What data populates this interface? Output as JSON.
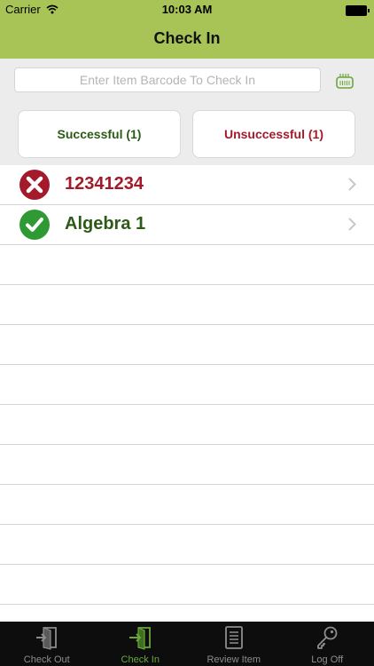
{
  "status_bar": {
    "carrier": "Carrier",
    "time": "10:03 AM"
  },
  "nav": {
    "title": "Check In"
  },
  "search": {
    "placeholder": "Enter Item Barcode To Check In",
    "value": ""
  },
  "filters": {
    "successful_label": "Successful (1)",
    "unsuccessful_label": "Unsuccessful (1)"
  },
  "items": [
    {
      "label": "12341234",
      "status": "error",
      "color": "#a31b2a"
    },
    {
      "label": "Algebra 1",
      "status": "success",
      "color": "#2d5a16"
    }
  ],
  "tabs": [
    {
      "label": "Check Out",
      "icon": "check-out-icon",
      "active": false
    },
    {
      "label": "Check In",
      "icon": "check-in-icon",
      "active": true
    },
    {
      "label": "Review Item",
      "icon": "review-item-icon",
      "active": false
    },
    {
      "label": "Log Off",
      "icon": "key-icon",
      "active": false
    }
  ],
  "colors": {
    "header": "#a8c457",
    "success": "#2d5a16",
    "error": "#a31b2a",
    "tab_active": "#6aa63a"
  }
}
